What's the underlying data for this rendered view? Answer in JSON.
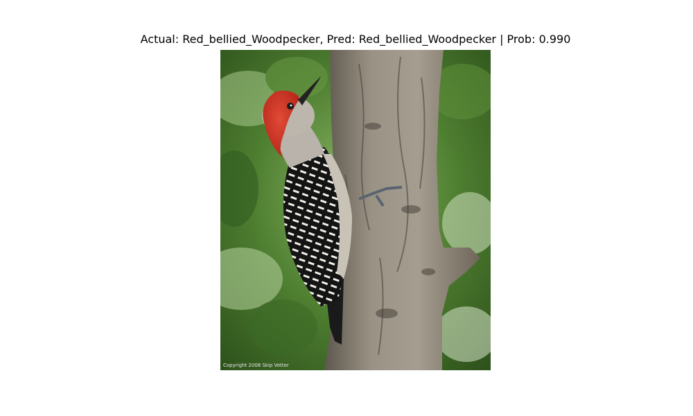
{
  "figure": {
    "title": "Actual: Red_bellied_Woodpecker, Pred: Red_bellied_Woodpecker | Prob: 0.990",
    "actual_label": "Red_bellied_Woodpecker",
    "predicted_label": "Red_bellied_Woodpecker",
    "probability": 0.99
  },
  "photo": {
    "subject": "red-bellied woodpecker clinging to a tree trunk",
    "watermark": "Copyright 2008 Skip Vetter"
  },
  "colors": {
    "background": "#ffffff",
    "foliage_dark": "#2f5a1f",
    "foliage_light": "#7fa857",
    "bark": "#8a8276",
    "head_red": "#d4382a",
    "plumage_gray": "#b9b3ab"
  }
}
